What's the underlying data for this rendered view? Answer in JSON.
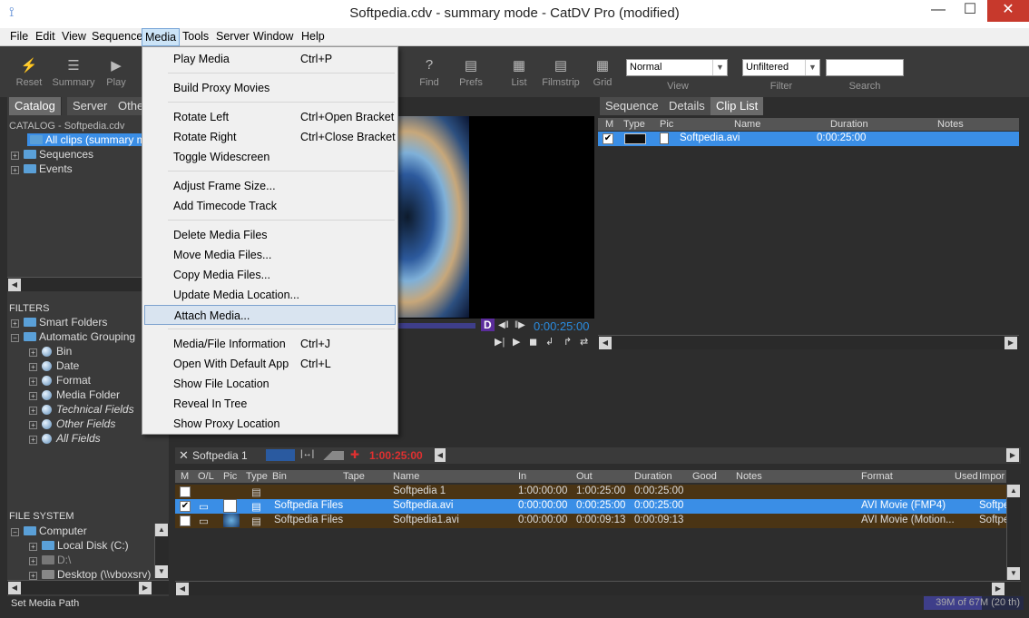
{
  "window": {
    "title": "Softpedia.cdv - summary mode - CatDV Pro (modified)",
    "minimize": "—",
    "maximize": "☐",
    "close": "✕"
  },
  "menubar": [
    "File",
    "Edit",
    "View",
    "Sequence",
    "Media",
    "Tools",
    "Server",
    "Window",
    "Help"
  ],
  "toolbar": {
    "reset": "Reset",
    "summary": "Summary",
    "play": "Play",
    "find": "Find",
    "prefs": "Prefs",
    "list": "List",
    "filmstrip": "Filmstrip",
    "grid": "Grid",
    "view_value": "Normal",
    "view_label": "View",
    "filter_value": "Unfiltered",
    "filter_label": "Filter",
    "search_value": "",
    "search_label": "Search"
  },
  "left": {
    "tabs": [
      "Catalog",
      "Server",
      "Other"
    ],
    "catalog_header": "CATALOG - Softpedia.cdv",
    "catalog_items": [
      "All clips (summary mode)",
      "Sequences",
      "Events"
    ],
    "filters_header": "FILTERS",
    "filters": [
      "Smart Folders",
      "Automatic Grouping",
      "Bin",
      "Date",
      "Format",
      "Media Folder",
      "Technical Fields",
      "Other Fields",
      "All Fields"
    ],
    "fs_header": "FILE SYSTEM",
    "fs_items": [
      "Computer",
      "Local Disk (C:)",
      "D:\\",
      "Desktop (\\\\vboxsrv)"
    ]
  },
  "dropdown": {
    "items": [
      {
        "label": "Play Media",
        "shortcut": "Ctrl+P"
      },
      {
        "label": "Build Proxy Movies",
        "shortcut": ""
      },
      {
        "label": "Rotate Left",
        "shortcut": "Ctrl+Open Bracket"
      },
      {
        "label": "Rotate Right",
        "shortcut": "Ctrl+Close Bracket"
      },
      {
        "label": "Toggle Widescreen",
        "shortcut": ""
      },
      {
        "label": "Adjust Frame Size...",
        "shortcut": ""
      },
      {
        "label": "Add Timecode Track",
        "shortcut": ""
      },
      {
        "label": "Delete Media Files",
        "shortcut": ""
      },
      {
        "label": "Move Media Files...",
        "shortcut": ""
      },
      {
        "label": "Copy Media Files...",
        "shortcut": ""
      },
      {
        "label": "Update Media Location...",
        "shortcut": ""
      },
      {
        "label": "Attach Media...",
        "shortcut": ""
      },
      {
        "label": "Media/File Information",
        "shortcut": "Ctrl+J"
      },
      {
        "label": "Open With Default App",
        "shortcut": "Ctrl+L"
      },
      {
        "label": "Show File Location",
        "shortcut": ""
      },
      {
        "label": "Reveal In Tree",
        "shortcut": ""
      },
      {
        "label": "Show Proxy Location",
        "shortcut": ""
      }
    ]
  },
  "preview": {
    "timecode": "0:00:25:00",
    "d_label": "D"
  },
  "right": {
    "tabs": [
      "Sequence",
      "Details",
      "Clip List"
    ],
    "headers": [
      "M",
      "Type",
      "Pic",
      "Name",
      "Duration",
      "Notes"
    ],
    "rows": [
      {
        "name": "Softpedia.avi",
        "duration": "0:00:25:00"
      }
    ]
  },
  "sequence": {
    "name": "Softpedia 1",
    "timecode": "1:00:25:00"
  },
  "bottom": {
    "headers": [
      "M",
      "O/L",
      "Pic",
      "Type",
      "Bin",
      "Tape",
      "Name",
      "In",
      "Out",
      "Duration",
      "Good",
      "Notes",
      "Format",
      "Used",
      "Impor"
    ],
    "rows": [
      {
        "bin": "",
        "name": "Softpedia 1",
        "in": "1:00:00:00",
        "out": "1:00:25:00",
        "duration": "0:00:25:00",
        "format": "",
        "imp": ""
      },
      {
        "bin": "Softpedia Files",
        "name": "Softpedia.avi",
        "in": "0:00:00:00",
        "out": "0:00:25:00",
        "duration": "0:00:25:00",
        "format": "AVI Movie (FMP4)",
        "imp": "Softpe"
      },
      {
        "bin": "Softpedia Files",
        "name": "Softpedia1.avi",
        "in": "0:00:00:00",
        "out": "0:00:09:13",
        "duration": "0:00:09:13",
        "format": "AVI Movie (Motion...",
        "imp": "Softpe"
      }
    ]
  },
  "status": {
    "text": "Set Media Path",
    "memory": "39M of 67M (20 th)",
    "memory_fraction": 0.58
  }
}
